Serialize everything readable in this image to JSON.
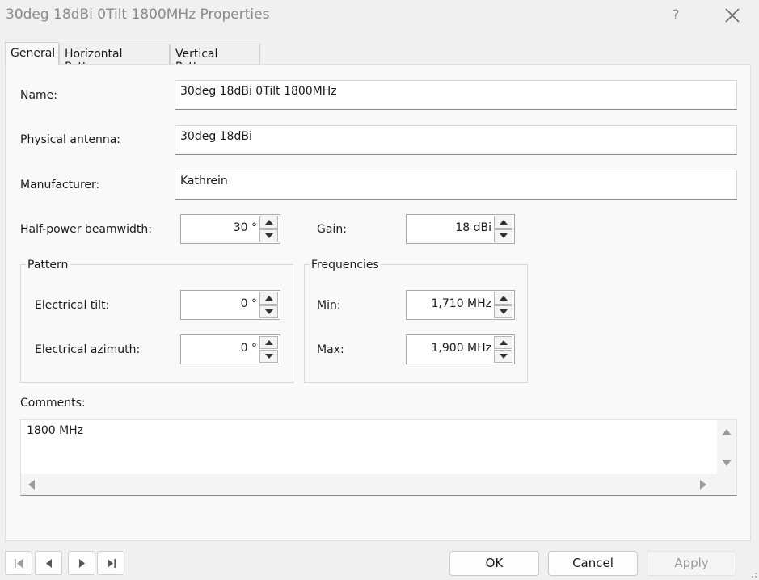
{
  "window": {
    "title": "30deg 18dBi 0Tilt 1800MHz Properties",
    "help_label": "?"
  },
  "tabs": [
    {
      "label": "General",
      "active": true
    },
    {
      "label": "Horizontal Pattern",
      "active": false
    },
    {
      "label": "Vertical Pattern",
      "active": false
    }
  ],
  "general": {
    "name": {
      "label": "Name:",
      "value": "30deg 18dBi 0Tilt 1800MHz"
    },
    "physical_antenna": {
      "label": "Physical antenna:",
      "value": "30deg 18dBi"
    },
    "manufacturer": {
      "label": "Manufacturer:",
      "value": "Kathrein"
    },
    "beamwidth": {
      "label": "Half-power beamwidth:",
      "value": "30 °"
    },
    "gain": {
      "label": "Gain:",
      "value": "18 dBi"
    },
    "pattern": {
      "title": "Pattern",
      "tilt": {
        "label": "Electrical tilt:",
        "value": "0 °"
      },
      "azimuth": {
        "label": "Electrical azimuth:",
        "value": "0 °"
      }
    },
    "frequencies": {
      "title": "Frequencies",
      "min": {
        "label": "Min:",
        "value": "1,710 MHz"
      },
      "max": {
        "label": "Max:",
        "value": "1,900 MHz"
      }
    },
    "comments": {
      "label": "Comments:",
      "value": "1800 MHz"
    }
  },
  "footer": {
    "ok_label": "OK",
    "cancel_label": "Cancel",
    "apply_label": "Apply",
    "apply_enabled": false
  },
  "colors": {
    "background": "#f0f0f0",
    "panel": "#f9f9f9",
    "title_text": "#8a8a8a",
    "disabled_text": "#9a9a9a"
  }
}
